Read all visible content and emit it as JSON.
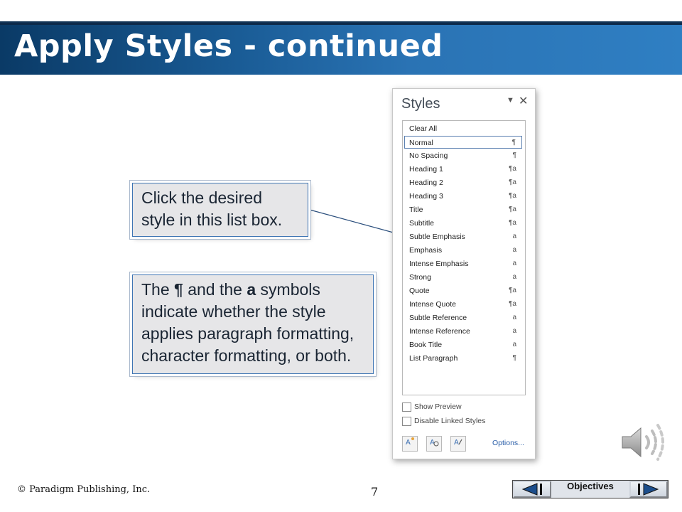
{
  "slide": {
    "title": "Apply Styles - continued",
    "page_number": "7",
    "copyright": "© Paradigm Publishing, Inc."
  },
  "callouts": {
    "list_box_line1": "Click the desired",
    "list_box_line2": "style in this list box.",
    "symbols_pre": "The ",
    "symbols_para": "¶",
    "symbols_mid": " and the ",
    "symbols_char": "a",
    "symbols_post1": " symbols",
    "symbols_line2": "indicate whether the style",
    "symbols_line3": "applies paragraph formatting,",
    "symbols_line4": "character formatting, or both."
  },
  "styles_pane": {
    "title": "Styles",
    "menu_icon": "dropdown-arrow",
    "close_icon": "close",
    "items": [
      {
        "label": "Clear All",
        "symbol": ""
      },
      {
        "label": "Normal",
        "symbol": "¶"
      },
      {
        "label": "No Spacing",
        "symbol": "¶"
      },
      {
        "label": "Heading 1",
        "symbol": "¶a"
      },
      {
        "label": "Heading 2",
        "symbol": "¶a"
      },
      {
        "label": "Heading 3",
        "symbol": "¶a"
      },
      {
        "label": "Title",
        "symbol": "¶a"
      },
      {
        "label": "Subtitle",
        "symbol": "¶a"
      },
      {
        "label": "Subtle Emphasis",
        "symbol": "a"
      },
      {
        "label": "Emphasis",
        "symbol": "a"
      },
      {
        "label": "Intense Emphasis",
        "symbol": "a"
      },
      {
        "label": "Strong",
        "symbol": "a"
      },
      {
        "label": "Quote",
        "symbol": "¶a"
      },
      {
        "label": "Intense Quote",
        "symbol": "¶a"
      },
      {
        "label": "Subtle Reference",
        "symbol": "a"
      },
      {
        "label": "Intense Reference",
        "symbol": "a"
      },
      {
        "label": "Book Title",
        "symbol": "a"
      },
      {
        "label": "List Paragraph",
        "symbol": "¶"
      }
    ],
    "selected_item": "Normal",
    "show_preview_label": "Show Preview",
    "disable_linked_label": "Disable Linked Styles",
    "options_label": "Options..."
  },
  "navigation": {
    "objectives_label": "Objectives"
  },
  "colors": {
    "title_bar": "#1a5c96",
    "callout_border": "#3d74b3"
  }
}
